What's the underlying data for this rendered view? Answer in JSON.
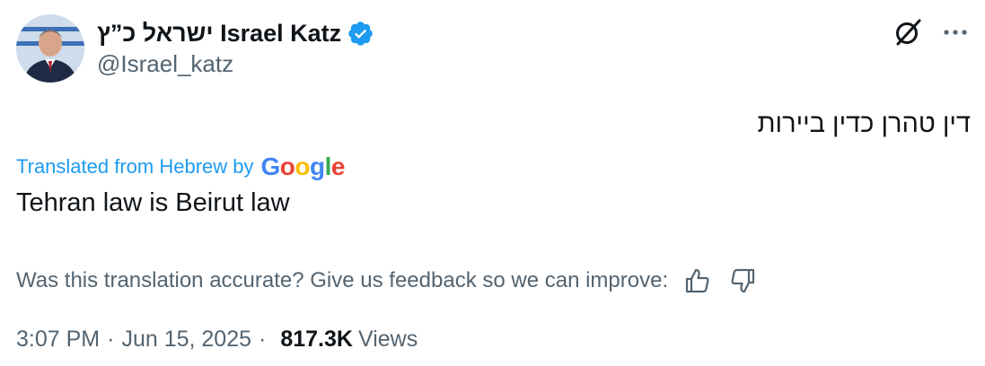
{
  "author": {
    "name": "ישראל כ”ץ Israel Katz",
    "handle": "@Israel_katz"
  },
  "icons": {
    "verified": "verified-badge-icon",
    "grok": "grok-icon",
    "more": "more-icon",
    "thumbs_up": "thumbs-up-icon",
    "thumbs_down": "thumbs-down-icon"
  },
  "colors": {
    "accent": "#1d9bf0",
    "text": "#0f1419",
    "secondary": "#536471"
  },
  "tweet": {
    "text": "דין טהרן כדין ביירות",
    "translated_label": "Translated from Hebrew by",
    "translation": "Tehran law is Beirut law"
  },
  "feedback": {
    "prompt": "Was this translation accurate? Give us feedback so we can improve:"
  },
  "meta": {
    "time": "3:07 PM",
    "date": "Jun 15, 2025",
    "views_count": "817.3K",
    "views_label": "Views"
  }
}
